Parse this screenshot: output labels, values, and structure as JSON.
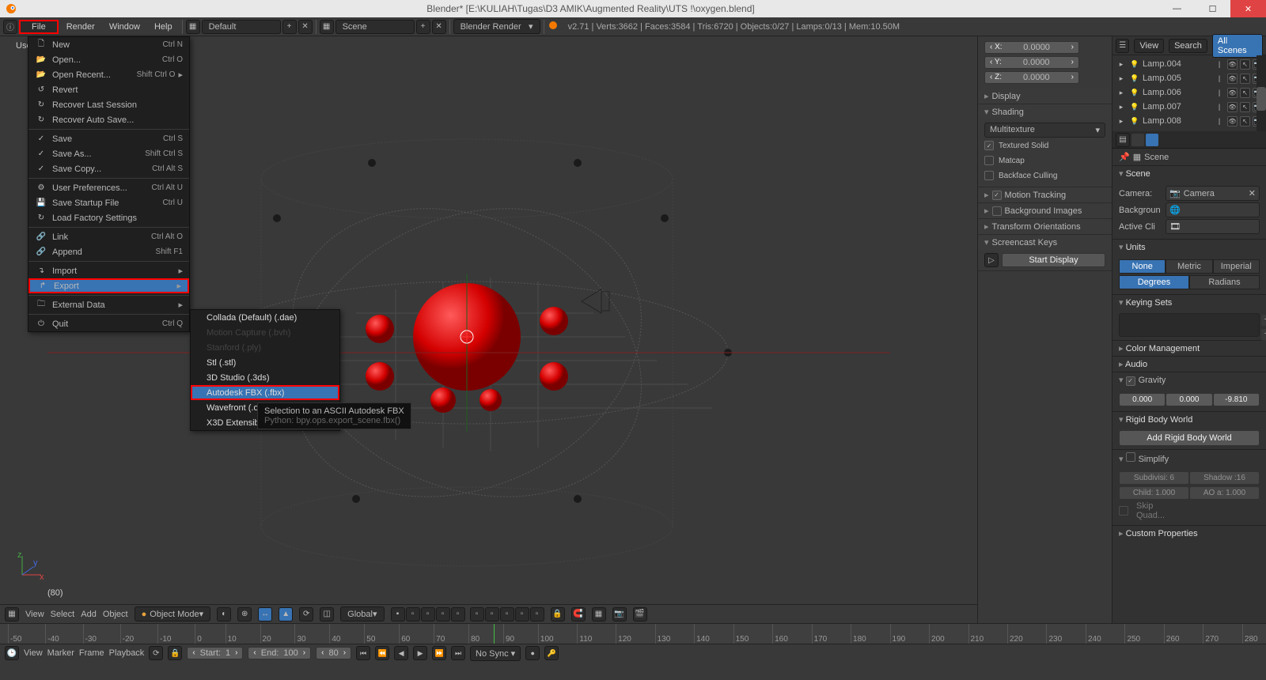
{
  "title": "Blender* [E:\\KULIAH\\Tugas\\D3 AMIK\\Augmented Reality\\UTS !\\oxygen.blend]",
  "menubar": {
    "items": [
      "File",
      "Render",
      "Window",
      "Help"
    ],
    "layout": "Default",
    "scene": "Scene",
    "engine": "Blender Render",
    "stats": "v2.71 | Verts:3662 | Faces:3584 | Tris:6720 | Objects:0/27 | Lamps:0/13 | Mem:10.50M"
  },
  "file_menu": [
    {
      "icon": "🗋",
      "label": "New",
      "shortcut": "Ctrl N"
    },
    {
      "icon": "📂",
      "label": "Open...",
      "shortcut": "Ctrl O"
    },
    {
      "icon": "📂",
      "label": "Open Recent...",
      "shortcut": "Shift Ctrl O",
      "arrow": true
    },
    {
      "icon": "↺",
      "label": "Revert",
      "shortcut": ""
    },
    {
      "icon": "↻",
      "label": "Recover Last Session",
      "shortcut": ""
    },
    {
      "icon": "↻",
      "label": "Recover Auto Save...",
      "shortcut": ""
    },
    {
      "sep": true
    },
    {
      "icon": "✓",
      "label": "Save",
      "shortcut": "Ctrl S"
    },
    {
      "icon": "✓",
      "label": "Save As...",
      "shortcut": "Shift Ctrl S"
    },
    {
      "icon": "✓",
      "label": "Save Copy...",
      "shortcut": "Ctrl Alt S"
    },
    {
      "sep": true
    },
    {
      "icon": "⚙",
      "label": "User Preferences...",
      "shortcut": "Ctrl Alt U"
    },
    {
      "icon": "💾",
      "label": "Save Startup File",
      "shortcut": "Ctrl U"
    },
    {
      "icon": "↻",
      "label": "Load Factory Settings",
      "shortcut": ""
    },
    {
      "sep": true
    },
    {
      "icon": "🔗",
      "label": "Link",
      "shortcut": "Ctrl Alt O"
    },
    {
      "icon": "🔗",
      "label": "Append",
      "shortcut": "Shift F1"
    },
    {
      "sep": true
    },
    {
      "icon": "↴",
      "label": "Import",
      "shortcut": "",
      "arrow": true
    },
    {
      "icon": "↱",
      "label": "Export",
      "shortcut": "",
      "arrow": true,
      "hi": true
    },
    {
      "sep": true
    },
    {
      "icon": "🗀",
      "label": "External Data",
      "shortcut": "",
      "arrow": true
    },
    {
      "sep": true
    },
    {
      "icon": "⏻",
      "label": "Quit",
      "shortcut": "Ctrl Q"
    }
  ],
  "export_menu": [
    {
      "label": "Collada (Default) (.dae)"
    },
    {
      "label": "Motion Capture (.bvh)",
      "dis": true
    },
    {
      "label": "Stanford (.ply)",
      "dis": true
    },
    {
      "label": "Stl (.stl)"
    },
    {
      "label": "3D Studio (.3ds)"
    },
    {
      "label": "Autodesk FBX (.fbx)",
      "hi": true
    },
    {
      "label": "Wavefront (.obj)"
    },
    {
      "label": "X3D Extensible 3D (.x3d)"
    }
  ],
  "tooltip": {
    "l1": "Selection to an ASCII Autodesk FBX",
    "l2": "Python: bpy.ops.export_scene.fbx()"
  },
  "viewport": {
    "frame_label": "(80)",
    "header": {
      "view": "View",
      "select": "Select",
      "add": "Add",
      "object": "Object",
      "mode": "Object Mode",
      "orient": "Global"
    }
  },
  "npanel": {
    "coords": {
      "x": "0.0000",
      "y": "0.0000",
      "z": "0.0000"
    },
    "sections": {
      "display": "Display",
      "shading": "Shading",
      "motion": "Motion Tracking",
      "bg": "Background Images",
      "trans": "Transform Orientations",
      "scr": "Screencast Keys"
    },
    "shading_mode": "Multitexture",
    "shading_opts": [
      "Textured Solid",
      "Matcap",
      "Backface Culling"
    ],
    "shading_checked": [
      true,
      false,
      false
    ],
    "start_display": "Start Display"
  },
  "outliner": {
    "buttons": {
      "view": "View",
      "search": "Search",
      "all": "All Scenes"
    },
    "rows": [
      {
        "name": "Lamp.004"
      },
      {
        "name": "Lamp.005"
      },
      {
        "name": "Lamp.006"
      },
      {
        "name": "Lamp.007"
      },
      {
        "name": "Lamp.008"
      }
    ]
  },
  "scene": {
    "breadcrumb": "Scene",
    "headers": {
      "scene": "Scene",
      "units": "Units",
      "keying": "Keying Sets",
      "color": "Color Management",
      "audio": "Audio",
      "gravity": "Gravity",
      "rigid": "Rigid Body World",
      "simplify": "Simplify",
      "custom": "Custom Properties"
    },
    "camera_label": "Camera:",
    "camera_value": "Camera",
    "bg_label": "Backgroun",
    "active_label": "Active Cli",
    "unit_sys": [
      "None",
      "Metric",
      "Imperial"
    ],
    "unit_ang": [
      "Degrees",
      "Radians"
    ],
    "gravity": [
      "0.000",
      "0.000",
      "-9.810"
    ],
    "rigid_btn": "Add Rigid Body World",
    "simplify": {
      "subd": "Subdivisi: 6",
      "shadow": "Shadow :16",
      "child": "Child: 1.000",
      "ao": "AO a: 1.000",
      "skip": "Skip Quad..."
    }
  },
  "timeline": {
    "ticks": [
      "-50",
      "-40",
      "-30",
      "-20",
      "-10",
      "0",
      "10",
      "20",
      "30",
      "40",
      "50",
      "60",
      "70",
      "80",
      "90",
      "100",
      "110",
      "120",
      "130",
      "140",
      "150",
      "160",
      "170",
      "180",
      "190",
      "200",
      "210",
      "220",
      "230",
      "240",
      "250",
      "260",
      "270",
      "280"
    ],
    "menus": [
      "View",
      "Marker",
      "Frame",
      "Playback"
    ],
    "start_lbl": "Start:",
    "start": "1",
    "end_lbl": "End:",
    "end": "100",
    "cur": "80",
    "sync": "No Sync"
  },
  "user_persp": "User"
}
